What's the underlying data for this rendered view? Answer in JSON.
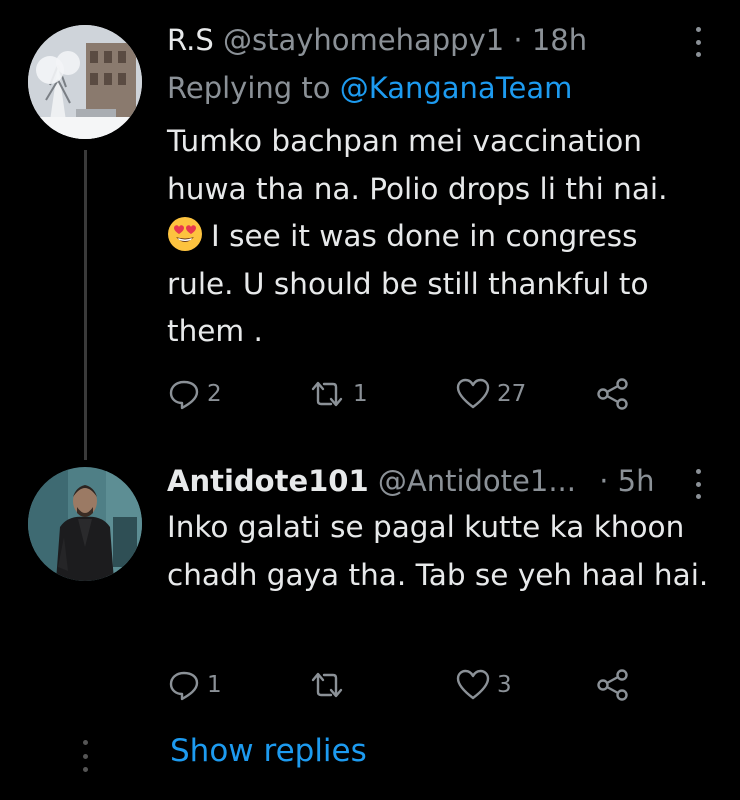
{
  "tweets": [
    {
      "name": "R.S",
      "handle": "@stayhomehappy1",
      "separator": "·",
      "time": "18h",
      "replying_prefix": "Replying to",
      "replying_to": "@KanganaTeam",
      "text_before_emoji": "Tumko bachpan mei vaccination huwa tha na. Polio drops li thi nai.",
      "emoji": "smiling-face-with-heart-eyes",
      "text_after_emoji": "I see it was done in congress rule. U should be still thankful to them .",
      "reply_count": "2",
      "retweet_count": "1",
      "like_count": "27"
    },
    {
      "name": "Antidote101",
      "handle": "@Antidote1...",
      "separator": "·",
      "time": "5h",
      "text": "Inko galati se pagal kutte ka khoon chadh gaya tha. Tab se yeh haal hai.",
      "reply_count": "1",
      "retweet_count": "",
      "like_count": "3"
    }
  ],
  "show_replies": "Show replies",
  "colors": {
    "background": "#000000",
    "text": "#e7e9ea",
    "secondary": "#8b9197",
    "accent": "#1d9bf0"
  }
}
